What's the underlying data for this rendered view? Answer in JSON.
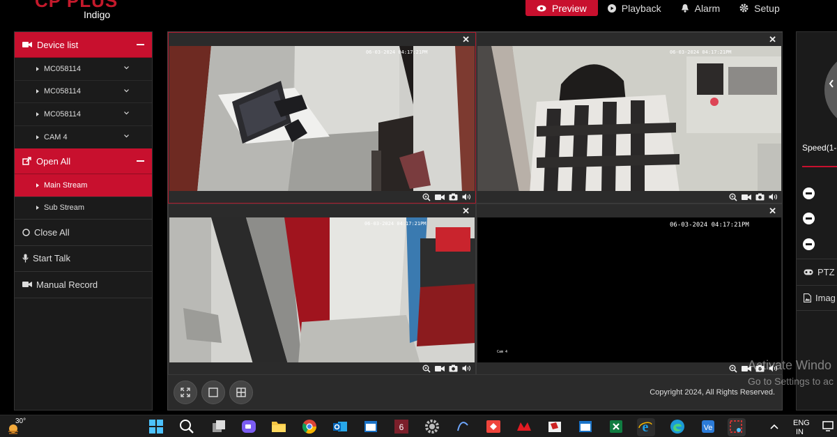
{
  "brand": {
    "name": "CP PLUS",
    "sub": "Indigo"
  },
  "nav": [
    {
      "label": "Preview",
      "icon": "eye-icon",
      "active": true
    },
    {
      "label": "Playback",
      "icon": "play-circle-icon"
    },
    {
      "label": "Alarm",
      "icon": "bell-icon"
    },
    {
      "label": "Setup",
      "icon": "gear-icon"
    }
  ],
  "sidebar": {
    "device_list": "Device list",
    "devices": [
      "MC058114",
      "MC058114",
      "MC058114",
      "CAM 4"
    ],
    "open_all": "Open All",
    "streams": [
      "Main Stream",
      "Sub Stream"
    ],
    "close_all": "Close All",
    "start_talk": "Start Talk",
    "manual_record": "Manual Record"
  },
  "cameras": [
    {
      "timestamp": "06-03-2024 04:17:21PM",
      "selected": true
    },
    {
      "timestamp": "06-03-2024 04:17:21PM"
    },
    {
      "timestamp": "06-03-2024 04:17:21PM"
    },
    {
      "timestamp": "06-03-2024 04:17:21PM",
      "small_text": "Cam 4"
    }
  ],
  "copyright": "Copyright 2024, All Rights Reserved.",
  "right_panel": {
    "speed_label": "Speed(1-",
    "ptz_label": "PTZ",
    "image_label": "Imag"
  },
  "windows_watermark": {
    "line1": "Activate Windo",
    "line2": "Go to Settings to ac"
  },
  "taskbar": {
    "temperature": "30°",
    "lang": "ENG",
    "lang2": "IN"
  },
  "colors": {
    "accent": "#c8102e",
    "panel": "#1b1b1b",
    "video_bg": "#2b2b2b"
  }
}
